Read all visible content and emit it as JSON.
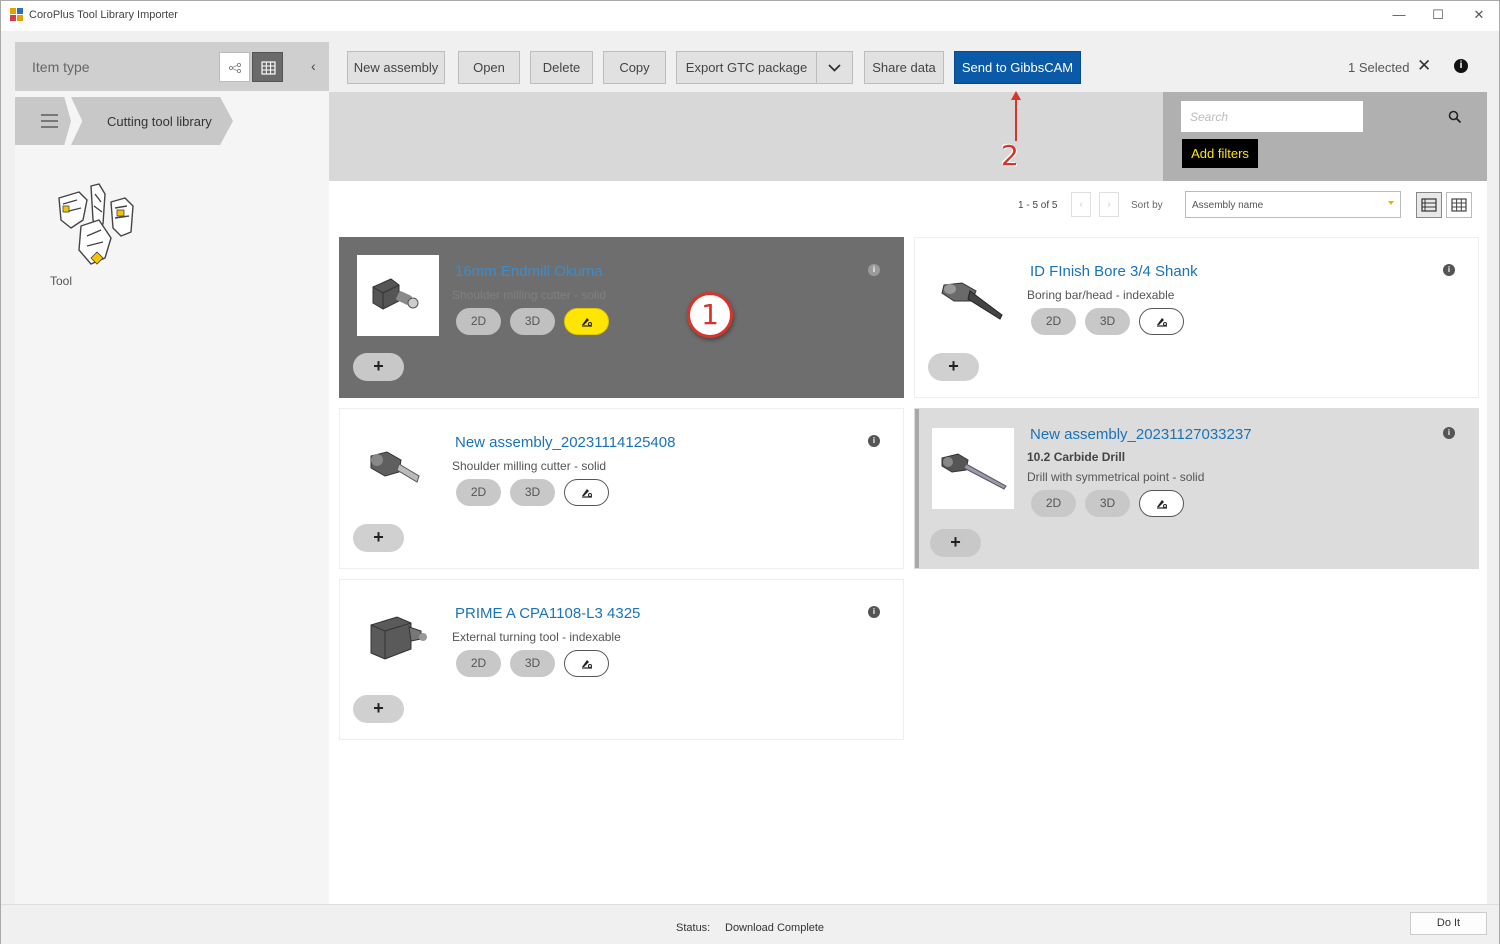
{
  "window": {
    "title": "CoroPlus Tool Library Importer",
    "minimize": "—",
    "maximize": "☐",
    "close": "✕"
  },
  "sidebar": {
    "item_type_label": "Item type",
    "collapse": "‹",
    "breadcrumb_label": "Cutting tool library",
    "tool_label": "Tool"
  },
  "toolbar": {
    "new_assembly": "New assembly",
    "open": "Open",
    "delete": "Delete",
    "copy": "Copy",
    "export_gtc": "Export GTC package",
    "share_data": "Share data",
    "send_to_gibbscam": "Send to GibbsCAM",
    "selected_count": "1 Selected",
    "clear_selection": "✕",
    "info": "i"
  },
  "search": {
    "placeholder": "Search",
    "add_filters": "Add filters"
  },
  "list": {
    "pager_text": "1 - 5 of 5",
    "prev": "‹",
    "next": "›",
    "sort_by_label": "Sort by",
    "sort_value": "Assembly name"
  },
  "cards": [
    {
      "name": "16mm Endmill Okuma",
      "line1": "Shoulder milling cutter - solid",
      "line2": "",
      "btn_2d": "2D",
      "btn_3d": "3D",
      "add": "+",
      "info": "i",
      "selected": true
    },
    {
      "name": "ID FInish Bore 3/4 Shank",
      "line1": "Boring bar/head - indexable",
      "line2": "",
      "btn_2d": "2D",
      "btn_3d": "3D",
      "add": "+",
      "info": "i",
      "selected": false
    },
    {
      "name": "New assembly_20231114125408",
      "line1": "Shoulder milling cutter - solid",
      "line2": "",
      "btn_2d": "2D",
      "btn_3d": "3D",
      "add": "+",
      "info": "i",
      "selected": false
    },
    {
      "name": "New assembly_20231127033237",
      "line1": "10.2 Carbide Drill",
      "line2": "Drill with symmetrical point - solid",
      "btn_2d": "2D",
      "btn_3d": "3D",
      "add": "+",
      "info": "i",
      "selected": false
    },
    {
      "name": "PRIME A CPA1108-L3 4325",
      "line1": "External turning tool - indexable",
      "line2": "",
      "btn_2d": "2D",
      "btn_3d": "3D",
      "add": "+",
      "info": "i",
      "selected": false
    }
  ],
  "annotations": {
    "marker1": "1",
    "marker2": "2"
  },
  "status": {
    "label": "Status:",
    "value": "Download Complete",
    "do_it": "Do It"
  },
  "colors": {
    "primary_button": "#0a5aa8",
    "selected_card": "#6e6e6e",
    "signature_highlight": "#ffe600",
    "link_text": "#1a73b8",
    "annotation_red": "#d7352c"
  }
}
